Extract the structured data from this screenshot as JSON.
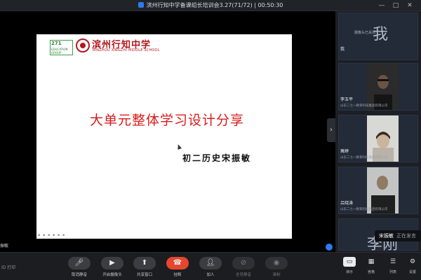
{
  "window": {
    "title": "滨州行知中学备课组长培训会3.27(71/72) | 00:50:30",
    "controls": [
      "—",
      "□",
      "✕"
    ]
  },
  "slide": {
    "logo_box_big": "271",
    "logo_box_small": "EDUCATION GROUP",
    "school_name_cn": "滨州行知中学",
    "school_name_en": "BINZHOU XINGZHI MIDDLE SCHOOL",
    "title": "大单元整体学习设计分享",
    "author": "初二历史宋振敏"
  },
  "stage": {
    "speaker_tag": "振敏"
  },
  "participants": [
    {
      "name": "我",
      "org": "",
      "avatar_char": "我",
      "status": "摄像头已关闭",
      "video": false
    },
    {
      "name": "李玉平",
      "org": "山东二七一教育科技集团有限公司",
      "video": true,
      "skin": "#6b5446"
    },
    {
      "name": "寓婷",
      "org": "山东二七一教育科技集团有限公司",
      "video": true,
      "skin": "#c9b59c"
    },
    {
      "name": "吕晓涛",
      "org": "山东二七一教育科技集团有限公司",
      "video": true,
      "skin": "#8f7a63"
    },
    {
      "name": "",
      "org": "",
      "avatar_char": "李刚",
      "video": false
    }
  ],
  "speaker_toast": {
    "name": "宋振敏",
    "status": "正在发言"
  },
  "toolbar": {
    "left_status": "ID 打印",
    "buttons": [
      {
        "label": "取消静音",
        "icon": "mic-icon"
      },
      {
        "label": "开启摄像头",
        "icon": "camera-icon"
      },
      {
        "label": "共享窗口",
        "icon": "share-icon"
      },
      {
        "label": "挂断",
        "icon": "hangup-icon"
      },
      {
        "label": "加人",
        "icon": "add-user-icon"
      },
      {
        "label": "全员静音",
        "icon": "mute-all-icon"
      },
      {
        "label": "录制",
        "icon": "record-icon"
      }
    ],
    "right_buttons": [
      {
        "label": "演示",
        "icon": "present-icon"
      },
      {
        "label": "宫格",
        "icon": "grid-icon"
      },
      {
        "label": "列表",
        "icon": "list-icon"
      },
      {
        "label": "设置",
        "icon": "gear-icon"
      }
    ]
  },
  "colors": {
    "accent": "#2d7bf4",
    "hangup": "#e5472e",
    "slide_title": "#d81c1c",
    "school_red": "#b2181f"
  }
}
